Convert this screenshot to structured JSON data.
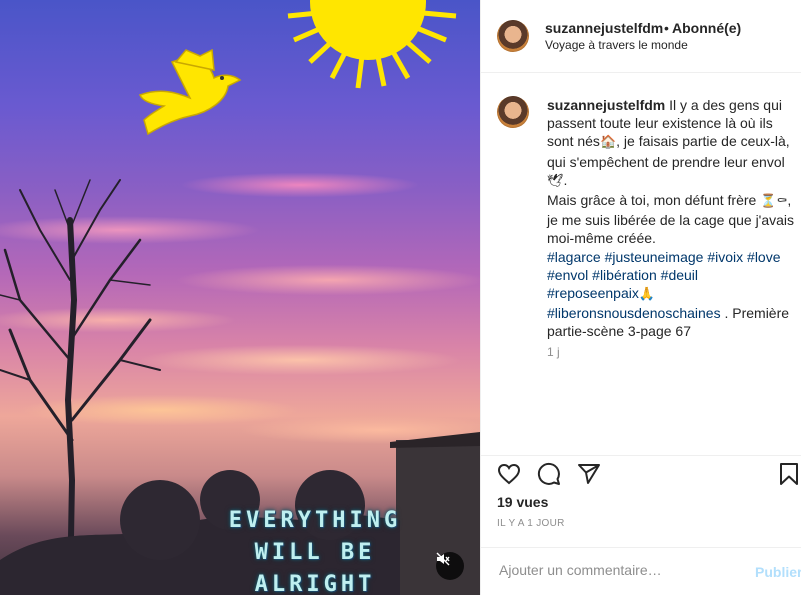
{
  "post": {
    "overlay_lines": [
      "EVERYTHING",
      "WILL BE",
      "ALRIGHT"
    ],
    "mute_icon": "speaker-muted-icon"
  },
  "header": {
    "username": "suzannejustelfdm",
    "separator": "•",
    "follow_status": "Abonné(e)",
    "location": "Voyage à travers le monde"
  },
  "caption": {
    "username": "suzannejustelfdm",
    "text_1": " Il y a des gens qui passent toute leur existence là où ils sont nés",
    "emoji_house": "🏠",
    "text_2": ", je faisais partie de ceux-là, qui s'empêchent de prendre leur envol ",
    "emoji_dove": "🕊",
    "text_3": ".",
    "text_4": "Mais grâce à toi, mon défunt frère ",
    "emoji_hourglass": "⏳",
    "emoji_coffin": "⚰",
    "text_5": ", je me suis libérée de la cage que j'avais moi-même créée.",
    "tags_1": [
      "#lagarce",
      "#justeuneimage",
      "#ivoix",
      "#love",
      "#envol",
      "#libération",
      "#deuil",
      "#reposeenpaix"
    ],
    "emoji_pray": "🙏",
    "tag_last": "#liberonsnousdenoschaines",
    "text_6": " . Première partie-scène 3-page 67",
    "time": "1 j"
  },
  "stats": {
    "views": "19 vues",
    "posted": "IL Y A 1 JOUR"
  },
  "comment": {
    "placeholder": "Ajouter un commentaire…",
    "publish_label": "Publier"
  },
  "colors": {
    "link": "#00376b",
    "publish_disabled": "#b2dffc",
    "sun": "#ffe600"
  }
}
